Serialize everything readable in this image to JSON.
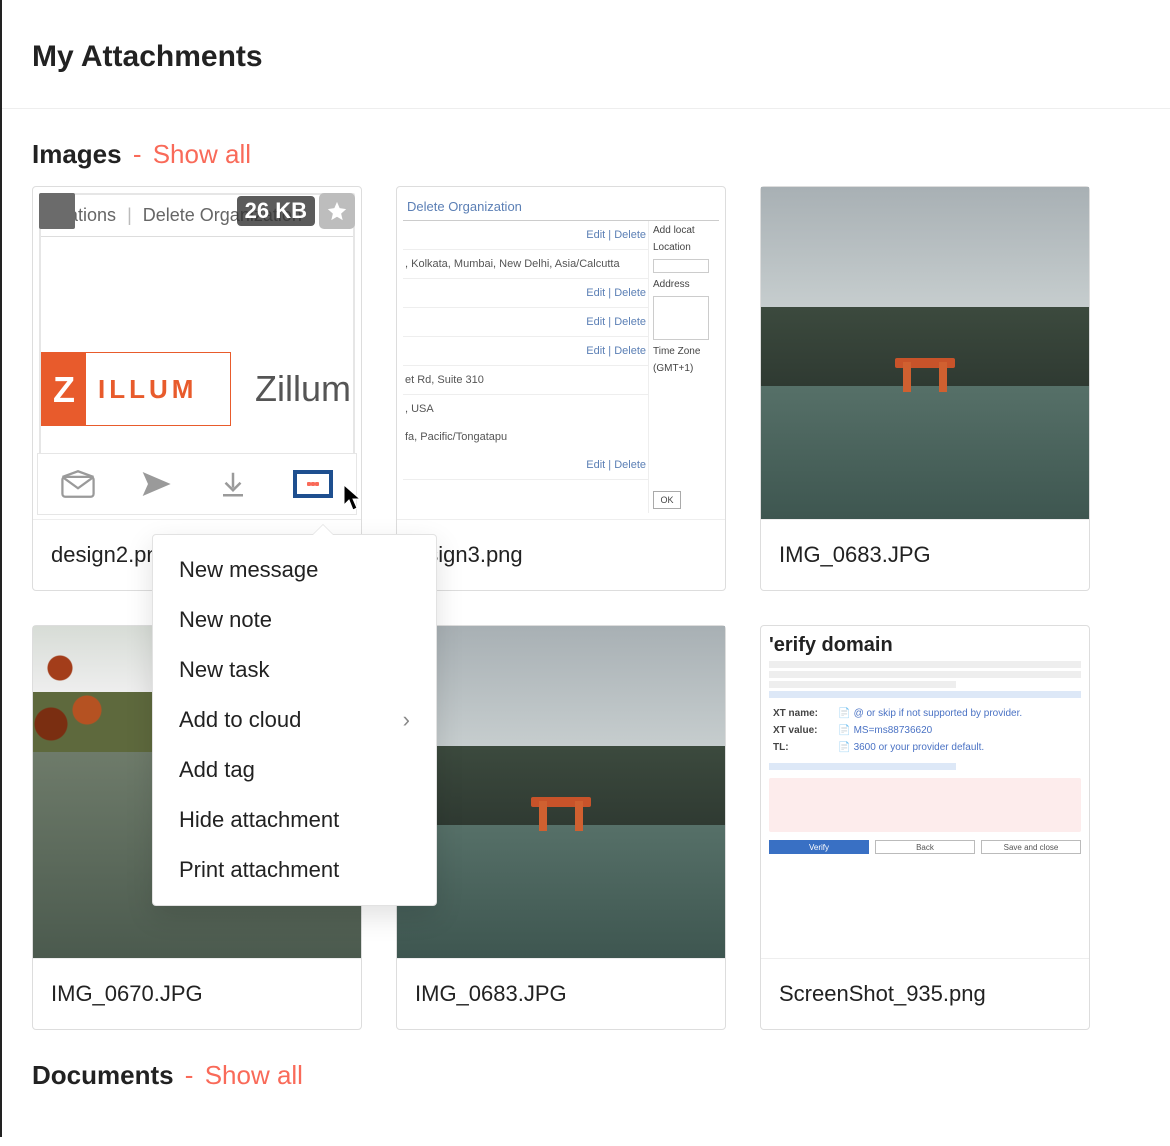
{
  "page_title": "My Attachments",
  "sections": {
    "images": {
      "title": "Images",
      "show_all": "Show all",
      "separator": " - "
    },
    "documents": {
      "title": "Documents",
      "show_all": "Show all",
      "separator": " - "
    }
  },
  "first_card": {
    "size_badge": "26 KB",
    "thumb_header_left": "ocations",
    "thumb_header_right": "Delete Organization",
    "logo_letter": "Z",
    "logo_text": "ILLUM",
    "brand_name": "Zillum"
  },
  "toolbar": {
    "mail": "mail-icon",
    "send": "send-icon",
    "download": "download-icon",
    "more": "more-icon"
  },
  "context_menu": [
    {
      "label": "New message",
      "submenu": false
    },
    {
      "label": "New note",
      "submenu": false
    },
    {
      "label": "New task",
      "submenu": false
    },
    {
      "label": "Add to cloud",
      "submenu": true
    },
    {
      "label": "Add tag",
      "submenu": false
    },
    {
      "label": "Hide attachment",
      "submenu": false
    },
    {
      "label": "Print attachment",
      "submenu": false
    }
  ],
  "cards": {
    "c1": {
      "filename": "design2.png"
    },
    "c2": {
      "filename": "esign3.png",
      "thumb_title": "Delete Organization",
      "row_text": ", Kolkata, Mumbai, New Delhi, Asia/Calcutta",
      "addr1": "et Rd, Suite 310",
      "addr2": ", USA",
      "addr3": "fa, Pacific/Tongatapu",
      "edit": "Edit",
      "delete": "Delete",
      "side_labels": [
        "Add locat",
        "Location",
        "Address",
        "Time Zone",
        "(GMT+1)"
      ],
      "ok": "OK"
    },
    "c3": {
      "filename": "IMG_0683.JPG"
    },
    "c4": {
      "filename": "IMG_0670.JPG"
    },
    "c5": {
      "filename": "IMG_0683.JPG"
    },
    "c6": {
      "filename": "ScreenShot_935.png",
      "thumb_title": "'erify domain",
      "xt_name_label": "XT name:",
      "xt_name_val": "@ or skip if not supported by provider.",
      "xt_value_label": "XT value:",
      "xt_value_val": "MS=ms88736620",
      "tl_label": "TL:",
      "tl_val": "3600 or your provider default.",
      "btn_verify": "Verify",
      "btn_back": "Back",
      "btn_save": "Save and close"
    }
  }
}
